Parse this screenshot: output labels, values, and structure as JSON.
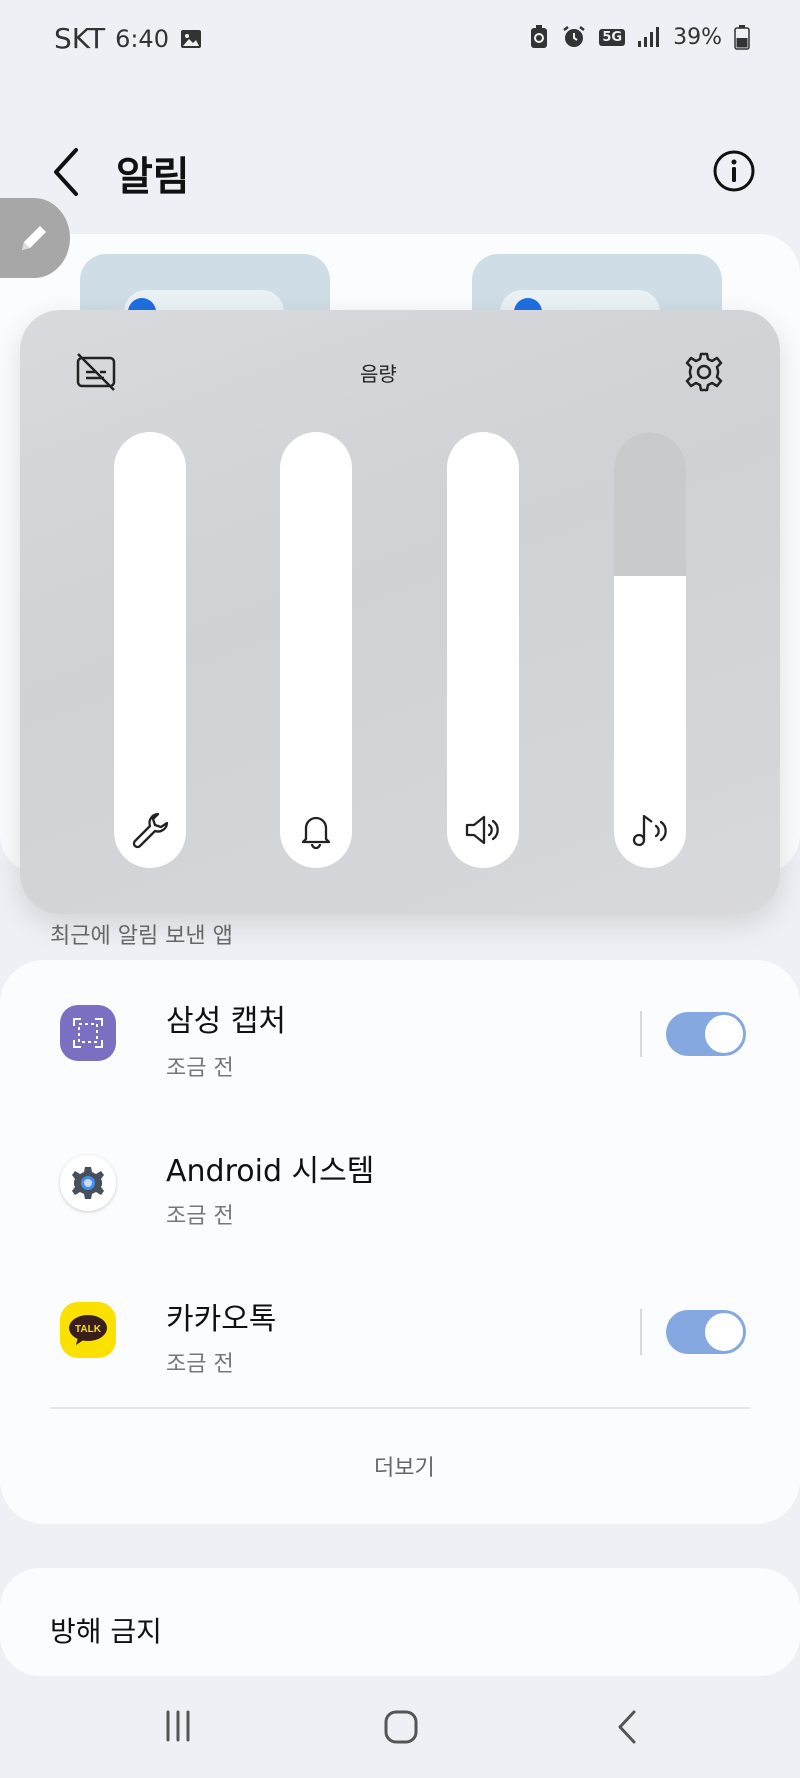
{
  "status_bar": {
    "carrier": "SKT",
    "time": "6:40",
    "network": "5G",
    "battery": "39%"
  },
  "header": {
    "title": "알림"
  },
  "volume_panel": {
    "title": "음량",
    "sliders": [
      {
        "name": "system",
        "icon": "wrench-icon",
        "level": 1.0
      },
      {
        "name": "notification",
        "icon": "bell-icon",
        "level": 1.0
      },
      {
        "name": "ringtone",
        "icon": "speaker-icon",
        "level": 1.0
      },
      {
        "name": "media",
        "icon": "music-note-icon",
        "level": 0.67
      }
    ]
  },
  "recent_apps": {
    "section_label": "최근에 알림 보낸 앱",
    "items": [
      {
        "name": "삼성 캡처",
        "time": "조금 전",
        "icon": "samsung-capture-icon",
        "enabled": true,
        "has_toggle": true
      },
      {
        "name": "Android 시스템",
        "time": "조금 전",
        "icon": "android-system-gear-icon",
        "enabled": true,
        "has_toggle": false
      },
      {
        "name": "카카오톡",
        "time": "조금 전",
        "icon": "kakaotalk-icon",
        "icon_text": "TALK",
        "enabled": true,
        "has_toggle": true
      }
    ],
    "more_label": "더보기"
  },
  "dnd": {
    "label": "방해 금지"
  },
  "colors": {
    "accent": "#1f6fe0",
    "toggle_on": "#86a8e0",
    "kakao_yellow": "#fae100",
    "capture_purple": "#7b6fc2"
  }
}
